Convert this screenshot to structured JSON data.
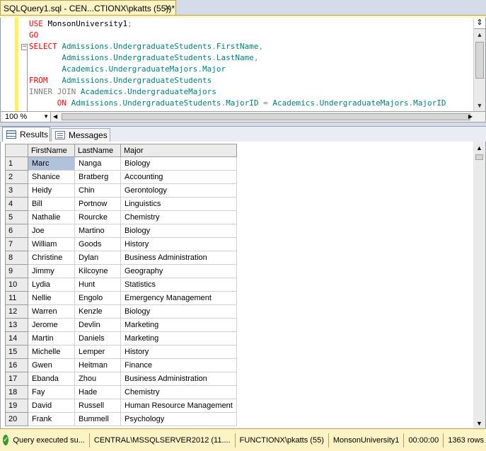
{
  "document_tab": {
    "title": "SQLQuery1.sql - CEN...CTIONX\\pkatts (55))*",
    "close_glyph": "✕"
  },
  "editor": {
    "collapse_glyph": "−",
    "lines": [
      [
        [
          "red",
          "USE "
        ],
        [
          "blk",
          "MonsonUniversity1"
        ],
        [
          "gray",
          ";"
        ]
      ],
      [
        [
          "red",
          "GO"
        ]
      ],
      [
        [
          "red",
          "SELECT "
        ],
        [
          "teal",
          "Admissions"
        ],
        [
          "gray",
          "."
        ],
        [
          "teal",
          "UndergraduateStudents"
        ],
        [
          "gray",
          "."
        ],
        [
          "teal",
          "FirstName"
        ],
        [
          "gray",
          ","
        ]
      ],
      [
        [
          "blk",
          "       "
        ],
        [
          "teal",
          "Admissions"
        ],
        [
          "gray",
          "."
        ],
        [
          "teal",
          "UndergraduateStudents"
        ],
        [
          "gray",
          "."
        ],
        [
          "teal",
          "LastName"
        ],
        [
          "gray",
          ","
        ]
      ],
      [
        [
          "blk",
          "       "
        ],
        [
          "teal",
          "Academics"
        ],
        [
          "gray",
          "."
        ],
        [
          "teal",
          "UndergraduateMajors"
        ],
        [
          "gray",
          "."
        ],
        [
          "teal",
          "Major"
        ]
      ],
      [
        [
          "red",
          "FROM   "
        ],
        [
          "teal",
          "Admissions"
        ],
        [
          "gray",
          "."
        ],
        [
          "teal",
          "UndergraduateStudents"
        ]
      ],
      [
        [
          "gray",
          "INNER JOIN "
        ],
        [
          "teal",
          "Academics"
        ],
        [
          "gray",
          "."
        ],
        [
          "teal",
          "UndergraduateMajors"
        ]
      ],
      [
        [
          "blk",
          "      "
        ],
        [
          "red",
          "ON "
        ],
        [
          "teal",
          "Admissions"
        ],
        [
          "gray",
          "."
        ],
        [
          "teal",
          "UndergraduateStudents"
        ],
        [
          "gray",
          "."
        ],
        [
          "teal",
          "MajorID"
        ],
        [
          "gray",
          " = "
        ],
        [
          "teal",
          "Academics"
        ],
        [
          "gray",
          "."
        ],
        [
          "teal",
          "UndergraduateMajors"
        ],
        [
          "gray",
          "."
        ],
        [
          "teal",
          "MajorID"
        ]
      ]
    ]
  },
  "zoom": {
    "value": "100 %"
  },
  "result_tabs": {
    "results": "Results",
    "messages": "Messages"
  },
  "grid": {
    "columns": [
      "",
      "FirstName",
      "LastName",
      "Major"
    ],
    "rows": [
      [
        "1",
        "Marc",
        "Nanga",
        "Biology"
      ],
      [
        "2",
        "Shanice",
        "Bratberg",
        "Accounting"
      ],
      [
        "3",
        "Heidy",
        "Chin",
        "Gerontology"
      ],
      [
        "4",
        "Bill",
        "Portnow",
        "Linguistics"
      ],
      [
        "5",
        "Nathalie",
        "Rourcke",
        "Chemistry"
      ],
      [
        "6",
        "Joe",
        "Martino",
        "Biology"
      ],
      [
        "7",
        "William",
        "Goods",
        "History"
      ],
      [
        "8",
        "Christine",
        "Dylan",
        "Business Administration"
      ],
      [
        "9",
        "Jimmy",
        "Kilcoyne",
        "Geography"
      ],
      [
        "10",
        "Lydia",
        "Hunt",
        "Statistics"
      ],
      [
        "11",
        "Nellie",
        "Engolo",
        "Emergency Management"
      ],
      [
        "12",
        "Warren",
        "Kenzle",
        "Biology"
      ],
      [
        "13",
        "Jerome",
        "Devlin",
        "Marketing"
      ],
      [
        "14",
        "Martin",
        "Daniels",
        "Marketing"
      ],
      [
        "15",
        "Michelle",
        "Lemper",
        "History"
      ],
      [
        "16",
        "Gwen",
        "Heitman",
        "Finance"
      ],
      [
        "17",
        "Ebanda",
        "Zhou",
        "Business Administration"
      ],
      [
        "18",
        "Fay",
        "Hade",
        "Chemistry"
      ],
      [
        "19",
        "David",
        "Russell",
        "Human Resource Management"
      ],
      [
        "20",
        "Frank",
        "Bummell",
        "Psychology"
      ]
    ]
  },
  "status_bar": {
    "check_glyph": "✓",
    "message": "Query executed su...",
    "server": "CENTRAL\\MSSQLSERVER2012 (11....",
    "user": "FUNCTIONX\\pkatts (55)",
    "database": "MonsonUniversity1",
    "elapsed": "00:00:00",
    "rows": "1363 rows"
  }
}
